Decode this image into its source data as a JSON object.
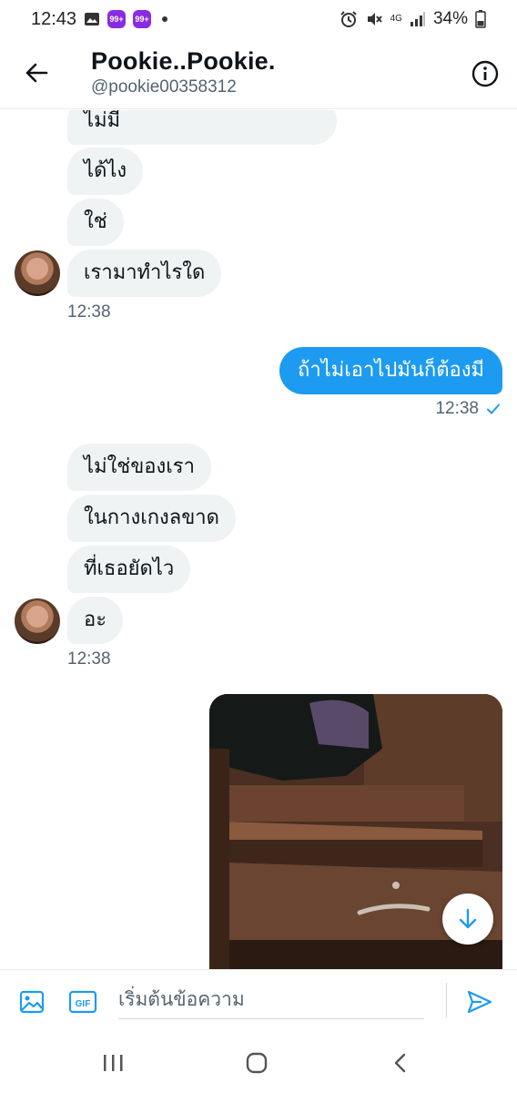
{
  "status_bar": {
    "time": "12:43",
    "network": "4G",
    "battery_percent": "34%",
    "app_badge": "99+"
  },
  "header": {
    "name": "Pookie..Pookie.",
    "handle": "@pookie00358312"
  },
  "messages": {
    "group1": [
      "ไม่มี",
      "ได้ไง",
      "ใช่",
      "เรามาทำไรใด"
    ],
    "group1_time": "12:38",
    "outgoing1": "ถ้าไม่เอาไปมันก็ต้องมี",
    "outgoing1_time": "12:38",
    "group2": [
      "ไม่ใช่ของเรา",
      "ในกางเกงลขาด",
      "ที่เธอยัดไว",
      "อะ"
    ],
    "group2_time": "12:38"
  },
  "composer": {
    "placeholder": "เริ่มต้นข้อความ",
    "gif_label": "GIF"
  },
  "colors": {
    "accent": "#1d9bf0",
    "incoming_bubble": "#eff3f4",
    "secondary_text": "#536471"
  }
}
